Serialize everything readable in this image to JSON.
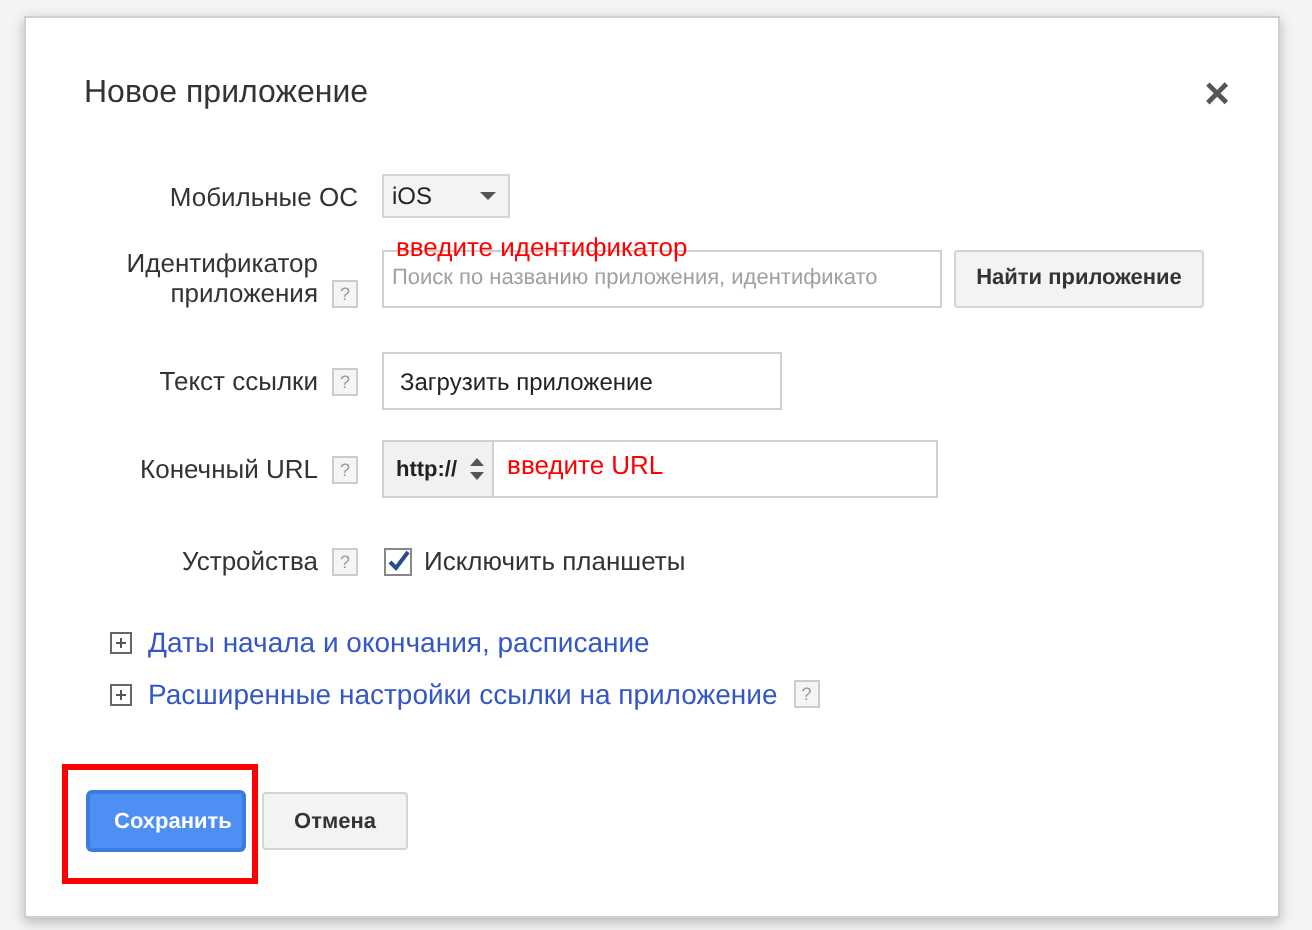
{
  "dialog": {
    "title": "Новое приложение",
    "close": "×",
    "fields": [
      {
        "kind": "select",
        "label": "Мобильные ОС",
        "value": "iOS"
      },
      {
        "kind": "search",
        "label": "Идентификатор приложения",
        "help": "?",
        "placeholder": "Поиск по названию приложения, идентификато",
        "button": "Найти приложение",
        "annotation": "введите идентификатор"
      },
      {
        "kind": "text",
        "label": "Текст ссылки",
        "help": "?",
        "value": "Загрузить приложение"
      },
      {
        "kind": "url",
        "label": "Конечный URL",
        "help": "?",
        "prefix": "http://",
        "annotation": "введите URL"
      },
      {
        "kind": "checkbox",
        "label": "Устройства",
        "help": "?",
        "checked": true,
        "text": "Исключить планшеты"
      }
    ],
    "sections": [
      {
        "label": "Даты начала и окончания, расписание",
        "expanded": false
      },
      {
        "label": "Расширенные настройки ссылки на приложение",
        "expanded": false,
        "help": "?"
      }
    ],
    "buttons": [
      {
        "label": "Сохранить",
        "kind": "primary",
        "highlighted": true
      },
      {
        "label": "Отмена",
        "kind": "secondary",
        "highlighted": false
      }
    ]
  }
}
